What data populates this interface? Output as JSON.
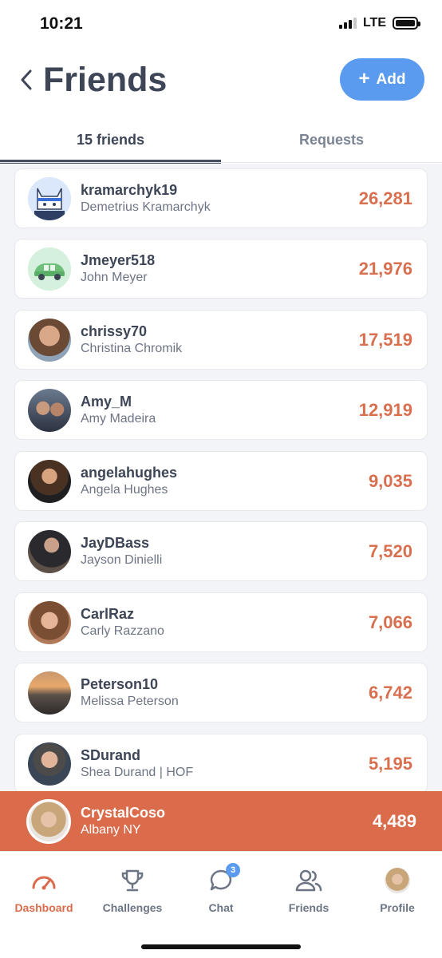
{
  "status": {
    "time": "10:21",
    "network": "LTE"
  },
  "header": {
    "title": "Friends",
    "add_label": "Add"
  },
  "tabs": [
    {
      "label": "15 friends",
      "active": true
    },
    {
      "label": "Requests",
      "active": false
    }
  ],
  "friends": [
    {
      "username": "kramarchyk19",
      "name": "Demetrius Kramarchyk",
      "score": "26,281",
      "avatar": "cat-avatar"
    },
    {
      "username": "Jmeyer518",
      "name": "John Meyer",
      "score": "21,976",
      "avatar": "car-avatar"
    },
    {
      "username": "chrissy70",
      "name": "Christina  Chromik",
      "score": "17,519",
      "avatar": "photo-avatar"
    },
    {
      "username": "Amy_M",
      "name": "Amy Madeira",
      "score": "12,919",
      "avatar": "photo-avatar"
    },
    {
      "username": "angelahughes",
      "name": "Angela Hughes",
      "score": "9,035",
      "avatar": "photo-avatar"
    },
    {
      "username": "JayDBass",
      "name": "Jayson Dinielli",
      "score": "7,520",
      "avatar": "photo-avatar"
    },
    {
      "username": "CarlRaz",
      "name": "Carly Razzano",
      "score": "7,066",
      "avatar": "photo-avatar"
    },
    {
      "username": "Peterson10",
      "name": "Melissa Peterson",
      "score": "6,742",
      "avatar": "photo-avatar"
    },
    {
      "username": "SDurand",
      "name": "Shea Durand | HOF",
      "score": "5,195",
      "avatar": "photo-avatar"
    }
  ],
  "me": {
    "username": "CrystalCoso",
    "name": "Albany NY",
    "score": "4,489"
  },
  "nav": [
    {
      "label": "Dashboard",
      "icon": "gauge-icon",
      "active": true
    },
    {
      "label": "Challenges",
      "icon": "trophy-icon",
      "active": false
    },
    {
      "label": "Chat",
      "icon": "chat-bubble-icon",
      "active": false,
      "badge": "3"
    },
    {
      "label": "Friends",
      "icon": "people-icon",
      "active": false
    },
    {
      "label": "Profile",
      "icon": "profile-avatar-icon",
      "active": false
    }
  ],
  "colors": {
    "accent": "#da6c4c",
    "score": "#d86f4e",
    "primary_button": "#5a9bef",
    "text": "#3d4556"
  }
}
